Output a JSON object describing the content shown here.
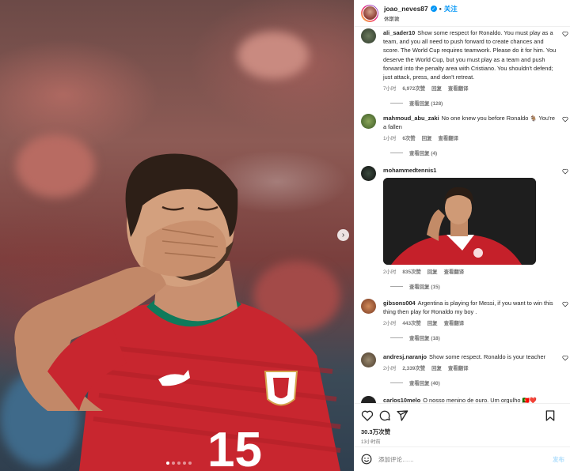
{
  "post": {
    "username": "joao_neves87",
    "follow_label": "关注",
    "location": "休斯敦",
    "likes": "30.3万次赞",
    "posted_ago": "13小时前",
    "comment_placeholder": "添加评论……",
    "post_button": "发布",
    "carousel_total": 5,
    "carousel_active": 0
  },
  "comments": [
    {
      "username": "ali_sader10",
      "text": "Show some respect for Ronaldo. You must play as a team, and you all need to push forward to create chances and score. The World Cup requires teamwork. Please do it for him. You deserve the World Cup, but you must play as a team and push forward into the penalty area with Cristiano. You shouldn't defend; just attack, press, and don't retreat.",
      "time": "7小时",
      "likes": "6,972次赞",
      "reply_label": "回复",
      "translate_label": "查看翻译",
      "view_replies": "查看回复 (128)",
      "avatar_color": "#3d4a3a"
    },
    {
      "username": "mahmoud_abu_zaki",
      "text": "No one knew you before Ronaldo 🐐 You're a fallen",
      "time": "1小时",
      "likes": "6次赞",
      "reply_label": "回复",
      "translate_label": "查看翻译",
      "view_replies": "查看回复 (4)",
      "avatar_color": "#4f6b3a"
    },
    {
      "username": "mohammedtennis1",
      "text": "",
      "time": "2小时",
      "likes": "835次赞",
      "reply_label": "回复",
      "translate_label": "查看翻译",
      "view_replies": "查看回复 (15)",
      "avatar_color": "#1d2a22"
    },
    {
      "username": "gibsons004",
      "text": "Argentina is playing for Messi, if you want to win this thing then play for Ronaldo my boy .",
      "time": "2小时",
      "likes": "443次赞",
      "reply_label": "回复",
      "translate_label": "查看翻译",
      "view_replies": "查看回复 (18)",
      "avatar_color": "#a35a3d"
    },
    {
      "username": "andresj.naranjo",
      "text": "Show some respect. Ronaldo is your teacher",
      "time": "2小时",
      "likes": "2,339次赞",
      "reply_label": "回复",
      "translate_label": "查看翻译",
      "view_replies": "查看回复 (40)",
      "avatar_color": "#6b5a4a"
    },
    {
      "username": "carlos10melo",
      "text": "O nosso menino de ouro. Um orgulho 🇵🇹❤️",
      "avatar_color": "#222222"
    }
  ],
  "colors": {
    "accent": "#0095f6",
    "jersey_red": "#c8262f",
    "jersey_collar": "#0f7a5b"
  },
  "icons": [
    "verified-icon",
    "more-icon",
    "heart-icon",
    "comment-icon",
    "share-icon",
    "save-icon",
    "emoji-icon",
    "chevron-right-icon"
  ]
}
